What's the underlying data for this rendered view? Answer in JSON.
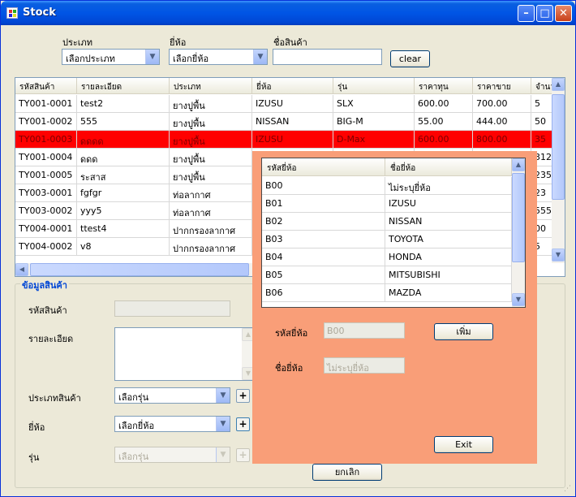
{
  "window": {
    "title": "Stock",
    "minimize_symbol": "–",
    "maximize_symbol": "□",
    "close_symbol": "✕"
  },
  "filters": {
    "type_label": "ประเภท",
    "type_value": "เลือกประเภท",
    "brand_label": "ยี่ห้อ",
    "brand_value": "เลือกยี่ห้อ",
    "name_label": "ชื่อสินค้า",
    "name_value": "",
    "clear_label": "clear"
  },
  "stock_table": {
    "columns": [
      "รหัสสินค้า",
      "รายละเอียด",
      "ประเภท",
      "ยี่ห้อ",
      "รุ่น",
      "ราคาทุน",
      "ราคาขาย",
      "จำนว"
    ],
    "rows": [
      [
        "TY001-0001",
        "test2",
        "ยางปูพื้น",
        "IZUSU",
        "SLX",
        "600.00",
        "700.00",
        "5"
      ],
      [
        "TY001-0002",
        "555",
        "ยางปูพื้น",
        "NISSAN",
        "BIG-M",
        "55.00",
        "444.00",
        "50"
      ],
      [
        "TY001-0003",
        "ดดดด",
        "ยางปูพื้น",
        "IZUSU",
        "D-Max",
        "600.00",
        "800.00",
        "35"
      ],
      [
        "TY001-0004",
        "ดดด",
        "ยางปูพื้น",
        "",
        "",
        "",
        "",
        "312"
      ],
      [
        "TY001-0005",
        "ระสาส",
        "ยางปูพื้น",
        "",
        "",
        "",
        "",
        "235"
      ],
      [
        "TY003-0001",
        "fgfgr",
        "ท่อลากาศ",
        "",
        "",
        "",
        "",
        "23"
      ],
      [
        "TY003-0002",
        "yyy5",
        "ท่อลากาศ",
        "",
        "",
        "",
        "",
        "555"
      ],
      [
        "TY004-0001",
        "ttest4",
        "ปากกรองลากาศ",
        "",
        "",
        "",
        "",
        "00"
      ],
      [
        "TY004-0002",
        "v8",
        "ปากกรองลากาศ",
        "",
        "",
        "",
        "",
        "5"
      ]
    ],
    "selected_row": 2
  },
  "details": {
    "group_title": "ข้อมูลสินค้า",
    "code_label": "รหัสสินค้า",
    "desc_label": "รายละเอียด",
    "category_label": "ประเภทสินค้า",
    "category_value": "เลือกรุ่น",
    "brand_label": "ยี่ห้อ",
    "brand_value": "เลือกยี่ห้อ",
    "model_label": "รุ่น",
    "model_value": "เลือกรุ่น",
    "plus_symbol": "+",
    "cancel_label": "ยกเลิก"
  },
  "brand_panel": {
    "columns": [
      "รหัสยี่ห้อ",
      "ชื่อยี่ห้อ"
    ],
    "rows": [
      [
        "B00",
        "ไม่ระบุยี่ห้อ"
      ],
      [
        "B01",
        "IZUSU"
      ],
      [
        "B02",
        "NISSAN"
      ],
      [
        "B03",
        "TOYOTA"
      ],
      [
        "B04",
        "HONDA"
      ],
      [
        "B05",
        "MITSUBISHI"
      ],
      [
        "B06",
        "MAZDA"
      ]
    ],
    "code_label": "รหัสยี่ห้อ",
    "code_value": "B00",
    "name_label": "ชื่อยี่ห้อ",
    "name_value": "ไม่ระบุยี่ห้อ",
    "add_label": "เพิ่ม",
    "exit_label": "Exit"
  },
  "icons": {
    "scroll_up": "▲",
    "scroll_down": "▼",
    "scroll_left": "◀",
    "scroll_right": "▶",
    "combo_arrow": "▼",
    "grip": "⋰"
  },
  "colors": {
    "selected_row": "#ff0000",
    "panel_bg": "#f99e78",
    "group_title": "#0046d5"
  }
}
